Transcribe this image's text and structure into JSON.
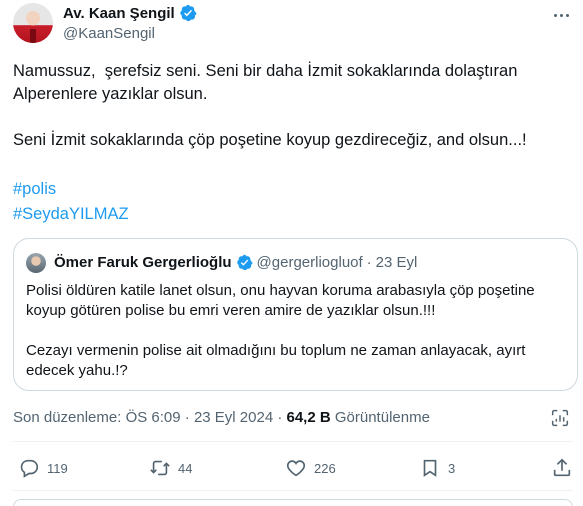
{
  "author": {
    "display_name": "Av. Kaan Şengil",
    "handle": "@KaanSengil",
    "verified": true
  },
  "tweet": {
    "text": "Namussuz,  şerefsiz seni. Seni bir daha İzmit sokaklarında dolaştıran\nAlperenlere yazıklar olsun.\n\nSeni İzmit sokaklarında çöp poşetine koyup gezdireceğiz, and olsun...!",
    "hashtags": [
      "#polis",
      "#SeydaYILMAZ"
    ]
  },
  "quote": {
    "display_name": "Ömer Faruk Gergerlioğlu",
    "handle": "@gergerliogluof",
    "separator": "·",
    "date": "23 Eyl",
    "text": "Polisi öldüren katile lanet olsun, onu hayvan koruma arabasıyla çöp poşetine\nkoyup götüren polise bu emri veren amire de yazıklar olsun.!!!\n\nCezayı vermenin polise ait olmadığını bu toplum ne zaman anlayacak, ayırt\nedecek yahu.!?"
  },
  "meta": {
    "edited_label": "Son düzenleme: ÖS 6:09 · 23 Eyl 2024 · ",
    "views_count": "64,2 B",
    "views_label": " Görüntülenme"
  },
  "actions": {
    "replies": "119",
    "retweets": "44",
    "likes": "226",
    "bookmarks": "3"
  },
  "icons": [
    "verified-badge-icon",
    "more-icon",
    "analytics-icon",
    "reply-icon",
    "retweet-icon",
    "like-icon",
    "bookmark-icon",
    "share-icon"
  ],
  "colors": {
    "link": "#1d9bf0",
    "secondary_text": "#536471",
    "verified": "#1d9bf0"
  }
}
